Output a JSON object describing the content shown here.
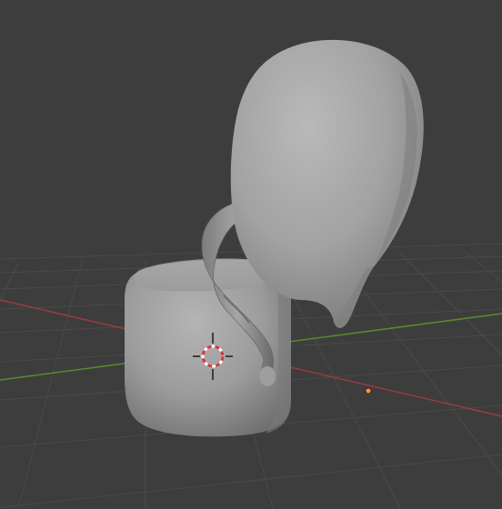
{
  "viewport": {
    "background_color": "#3d3d3d",
    "grid_color": "#4a4a4a",
    "x_axis_color": "#9c3a42",
    "y_axis_color": "#5a8a2e",
    "mesh_color": "#9a9a9a",
    "origin_color": "#f09433"
  },
  "objects": [
    {
      "name": "rounded-cube-mesh"
    },
    {
      "name": "curved-handle-mesh"
    },
    {
      "name": "blob-sculpt-mesh"
    }
  ],
  "overlays": [
    {
      "name": "3d-cursor-icon"
    },
    {
      "name": "object-origin-dot"
    }
  ]
}
